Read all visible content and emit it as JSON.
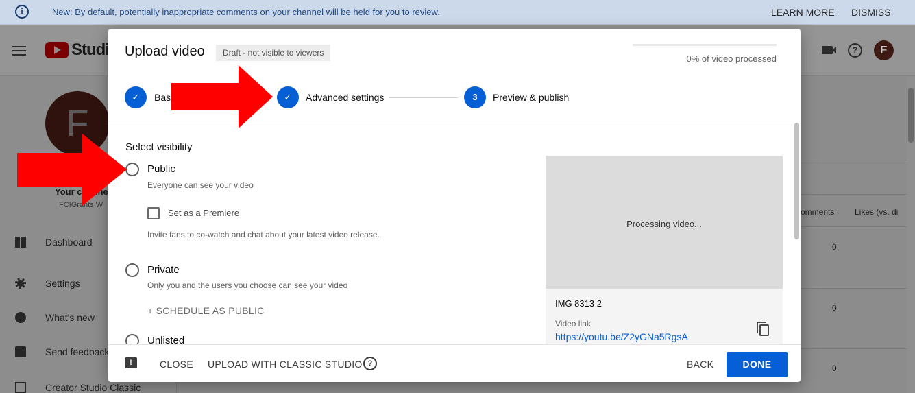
{
  "banner": {
    "message": "New: By default, potentially inappropriate comments on your channel will be held for you to review.",
    "learn_more": "LEARN MORE",
    "dismiss": "DISMISS"
  },
  "topbar": {
    "brand": "Studio",
    "avatar_letter": "F",
    "help_glyph": "?"
  },
  "sidebar": {
    "avatar_letter": "F",
    "channel_title": "Your channel",
    "channel_name": "FCIGrants W",
    "items": [
      {
        "label": "Dashboard",
        "icon": "dashboard-icon"
      },
      {
        "label": "Settings",
        "icon": "gear-icon"
      },
      {
        "label": "What's new",
        "icon": "badge-icon"
      },
      {
        "label": "Send feedback",
        "icon": "feedback-icon"
      },
      {
        "label": "Creator Studio Classic",
        "icon": "classic-icon"
      }
    ]
  },
  "background_table": {
    "col_comments": "omments",
    "col_likes": "Likes (vs. di",
    "values": [
      "0",
      "0",
      "0"
    ]
  },
  "dialog": {
    "title": "Upload video",
    "badge": "Draft - not visible to viewers",
    "progress_percent": 0,
    "progress_text": "0% of video processed",
    "steps": [
      {
        "label": "Basic info",
        "marker": "✓"
      },
      {
        "label": "Advanced settings",
        "marker": "✓"
      },
      {
        "label": "Preview & publish",
        "marker": "3"
      }
    ],
    "visibility": {
      "section_title": "Select visibility",
      "public_label": "Public",
      "public_desc": "Everyone can see your video",
      "premiere_label": "Set as a Premiere",
      "premiere_desc": "Invite fans to co-watch and chat about your latest video release.",
      "private_label": "Private",
      "private_desc": "Only you and the users you choose can see your video",
      "schedule_label": "+ SCHEDULE AS PUBLIC",
      "unlisted_label": "Unlisted"
    },
    "preview": {
      "processing_text": "Processing video...",
      "file_name": "IMG 8313 2",
      "link_label": "Video link",
      "link_url": "https://youtu.be/Z2yGNa5RgsA"
    },
    "footer": {
      "feedback_glyph": "!",
      "close": "CLOSE",
      "classic": "UPLOAD WITH CLASSIC STUDIO",
      "help_glyph": "?",
      "back": "BACK",
      "done": "DONE"
    }
  },
  "colors": {
    "accent": "#065fd4",
    "arrow": "#ff0000",
    "overlay": "#8c8c8c"
  }
}
